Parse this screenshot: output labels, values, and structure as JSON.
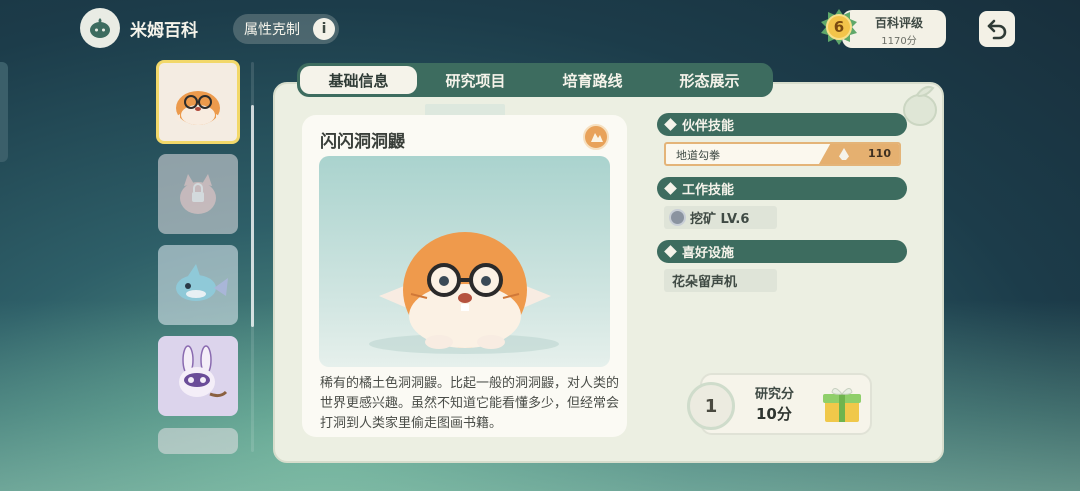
{
  "header": {
    "title": "米姆百科",
    "attribute_chip": "属性克制",
    "info_glyph": "i",
    "rating_label": "百科评级",
    "rating_points": "1170分",
    "rating_level": "6"
  },
  "tabs": [
    "基础信息",
    "研究项目",
    "培育路线",
    "形态展示"
  ],
  "active_tab": 0,
  "pal": {
    "name": "闪闪洞洞鼹",
    "description": "稀有的橘土色洞洞鼹。比起一般的洞洞鼹，对人类的世界更感兴趣。虽然不知道它能看懂多少，但经常会打洞到人类家里偷走图画书籍。"
  },
  "sections": {
    "partner_skill": {
      "header": "伙伴技能",
      "skill_name": "地道勾拳",
      "skill_power": "110"
    },
    "work_skill": {
      "header": "工作技能",
      "value": "挖矿 LV.6"
    },
    "favorite_facility": {
      "header": "喜好设施",
      "value": "花朵留声机"
    }
  },
  "research": {
    "count": "1",
    "label": "研究分",
    "value": "10分"
  },
  "list_items": [
    {
      "icon": "orange-mole-pal-icon",
      "selected": true
    },
    {
      "icon": "locked-cat-pal-icon",
      "selected": false
    },
    {
      "icon": "blue-fish-pal-icon",
      "selected": false
    },
    {
      "icon": "purple-rabbit-pal-icon",
      "selected": false
    },
    {
      "icon": "partial-pal-icon",
      "selected": false
    }
  ],
  "colors": {
    "tab_bg": "#3d6c5f",
    "panel_bg": "#ecefe2",
    "selected_border": "#f2d86a",
    "skill_accent": "#e5b070"
  }
}
